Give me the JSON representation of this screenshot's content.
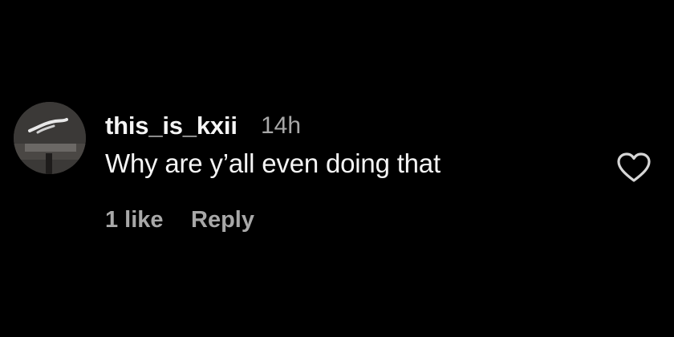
{
  "comment": {
    "username": "this_is_kxii",
    "timestamp": "14h",
    "text": "Why are y’all even doing that",
    "likes_label": "1 like",
    "reply_label": "Reply",
    "avatar_icon": "user-avatar-photo",
    "like_icon": "heart-outline-icon"
  },
  "colors": {
    "background": "#000000",
    "primary_text": "#f5f5f5",
    "secondary_text": "#a8a8a8"
  }
}
